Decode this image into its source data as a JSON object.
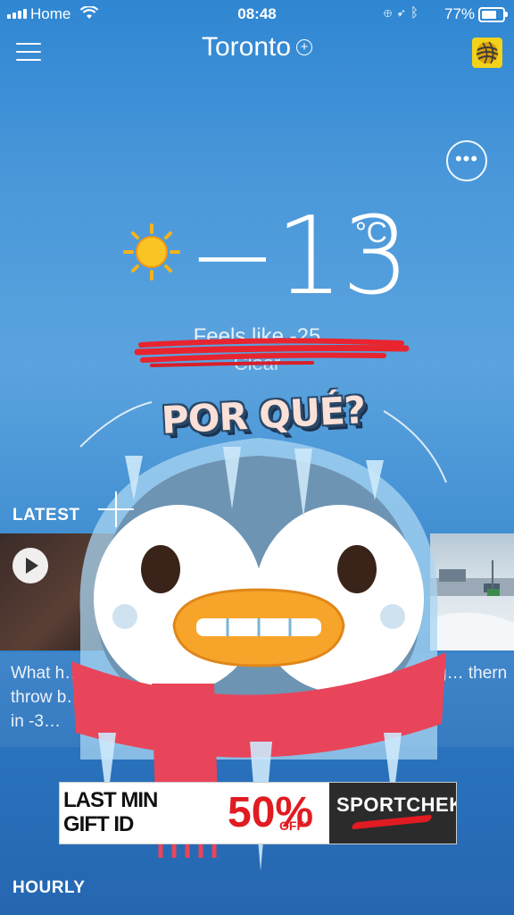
{
  "status_bar": {
    "carrier": "Home",
    "time": "08:48",
    "battery": "77%"
  },
  "header": {
    "city": "Toronto",
    "menu_icon": "hamburger-menu-icon",
    "add_icon": "plus-circle-icon",
    "logo_icon": "weather-network-logo"
  },
  "current": {
    "temperature": "−13",
    "unit": "°C",
    "feels_like": "Feels like -25",
    "condition": "Clear",
    "condition_icon": "sun-icon",
    "more_icon": "more-dots-icon"
  },
  "latest": {
    "title": "LATEST",
    "cards": [
      {
        "text": "What h… throw b… air in -3…",
        "has_video": true
      },
      {
        "text": "g… thern"
      }
    ]
  },
  "ad": {
    "left_line1": "LAST MIN",
    "left_line2": "GIFT ID",
    "percent": "50%",
    "off": "OFF*",
    "brand": "SPORTCHEK"
  },
  "sticker": {
    "text": "POR QUÉ?",
    "name": "freezing-penguin-sticker"
  },
  "hourly": {
    "title": "HOURLY"
  },
  "colors": {
    "sky_blue": "#4a98da",
    "scribble_red": "#e8242f",
    "ad_red": "#e11b22"
  }
}
